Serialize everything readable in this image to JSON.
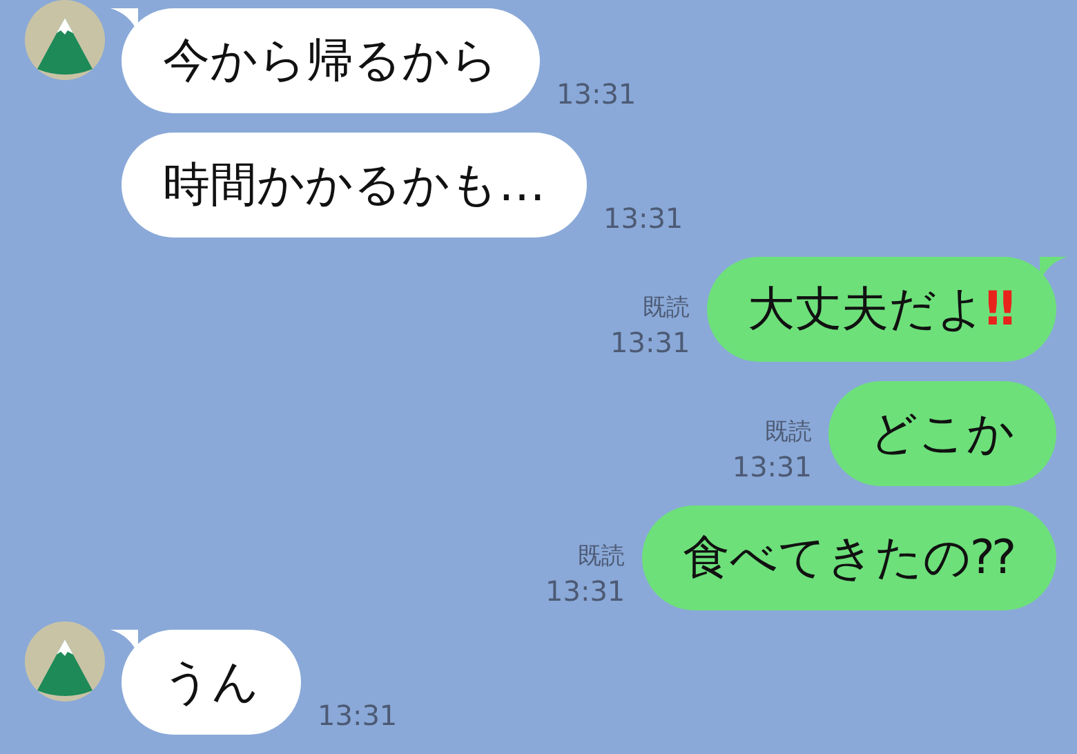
{
  "messages": [
    {
      "kind": "incoming",
      "avatar": true,
      "text": "今から帰るから",
      "time": "13:31"
    },
    {
      "kind": "incoming",
      "avatar": false,
      "text": "時間かかるかも…",
      "time": "13:31"
    },
    {
      "kind": "outgoing",
      "read_label": "既読",
      "text": "大丈夫だよ",
      "emoji": "‼",
      "time": "13:31"
    },
    {
      "kind": "outgoing",
      "read_label": "既読",
      "text": "どこか",
      "time": "13:31"
    },
    {
      "kind": "outgoing",
      "read_label": "既読",
      "text": "食べてきたの⁇",
      "time": "13:31"
    },
    {
      "kind": "incoming",
      "avatar": true,
      "text": "うん",
      "time": "13:31"
    }
  ]
}
